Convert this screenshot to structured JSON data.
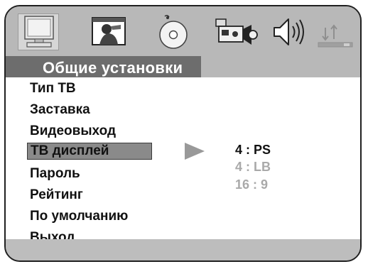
{
  "header": {
    "icons": [
      {
        "name": "tv-monitor-icon",
        "selected": true
      },
      {
        "name": "picture-icon"
      },
      {
        "name": "disc-icon"
      },
      {
        "name": "video-camera-icon"
      },
      {
        "name": "speaker-icon"
      },
      {
        "name": "preferences-icon"
      }
    ]
  },
  "section_title": "Общие установки",
  "menu": {
    "items": [
      {
        "label": "Тип ТВ"
      },
      {
        "label": "Заставка"
      },
      {
        "label": "Видеовыход"
      },
      {
        "label": "ТВ дисплей",
        "selected": true
      },
      {
        "label": "Пароль"
      },
      {
        "label": "Рейтинг"
      },
      {
        "label": "По умолчанию"
      },
      {
        "label": "Выход"
      }
    ]
  },
  "options": {
    "items": [
      {
        "label": "4 : PS",
        "active": true
      },
      {
        "label": "4 : LB",
        "active": false
      },
      {
        "label": "16 : 9",
        "active": false
      }
    ]
  },
  "colors": {
    "frame_background": "#bdbdbd",
    "title_bar": "#6d6d6d",
    "selected_item": "#8a8a8a",
    "inactive_option": "#a9a9a9"
  }
}
